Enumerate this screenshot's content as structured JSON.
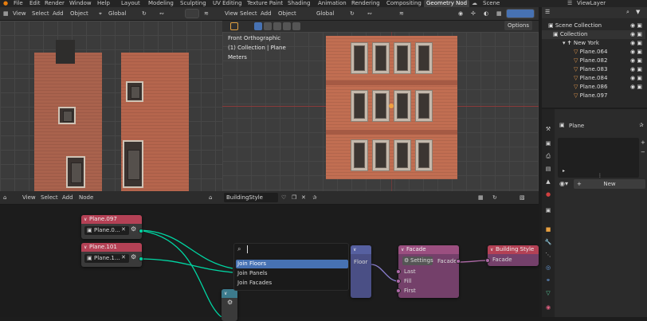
{
  "topbar": {
    "menu": [
      "File",
      "Edit",
      "Render",
      "Window",
      "Help"
    ],
    "workspaces": [
      "Layout",
      "Modeling",
      "Sculpting",
      "UV Editing",
      "Texture Paint",
      "Shading",
      "Animation",
      "Rendering",
      "Compositing",
      "Geometry Nod"
    ],
    "scene_label": "Scene",
    "view_layer_label": "ViewLayer"
  },
  "left_viewport": {
    "menu": [
      "View",
      "Select",
      "Add",
      "Object"
    ],
    "orientation": "Global"
  },
  "right_viewport": {
    "menu": [
      "View",
      "Select",
      "Add",
      "Object"
    ],
    "orientation": "Global",
    "info_line1": "Front Orthographic",
    "info_line2": "(1) Collection | Plane",
    "info_line3": "Meters",
    "options_label": "Options"
  },
  "node_editor": {
    "menu": [
      "View",
      "Select",
      "Add",
      "Node"
    ],
    "tree_name": "BuildingStyle",
    "nodes": {
      "plane097": {
        "title": "Plane.097",
        "field": "Plane.0..."
      },
      "plane101": {
        "title": "Plane.101",
        "field": "Plane.1..."
      },
      "floor": {
        "label": "Floor"
      },
      "facade": {
        "title": "Facade",
        "settings_label": "Settings",
        "output_label": "Facade",
        "inputs": [
          "Last",
          "Fill",
          "First"
        ]
      },
      "building_style": {
        "title": "Building Style",
        "input_label": "Facade"
      }
    },
    "search": {
      "value": "",
      "results": [
        "Join Floors",
        "Join Panels",
        "Join Facades"
      ]
    }
  },
  "outliner": {
    "root": "Scene Collection",
    "collection": "Collection",
    "group": "New York",
    "items": [
      "Plane.064",
      "Plane.082",
      "Plane.083",
      "Plane.084",
      "Plane.086",
      "Plane.097"
    ]
  },
  "properties": {
    "object_name": "Plane",
    "new_button": "New"
  },
  "colors": {
    "object_header": "#b44155",
    "group_header": "#3c7a8c",
    "geometry_socket": "#00d6a3",
    "facade_node": "#9b4f80",
    "search_highlight": "#4772b3",
    "floor_node": "#5660a0"
  }
}
